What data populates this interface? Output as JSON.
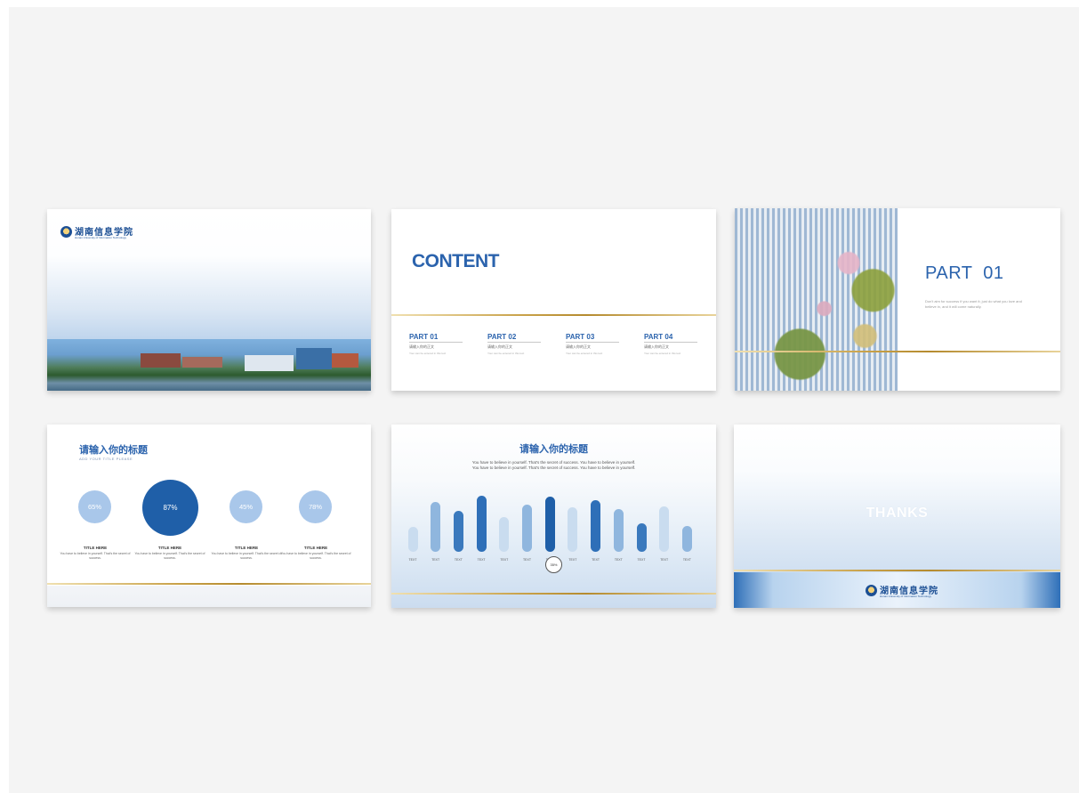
{
  "colors": {
    "background": "#f4f4f4",
    "primary_blue": "#2b63ad",
    "gold": "#c9a24a"
  },
  "slide1": {
    "logo_cn": "湖南信息学院",
    "logo_en": "Hunan University of Information Technology"
  },
  "slide2": {
    "title": "CONTENT",
    "parts": [
      {
        "title": "PART 01",
        "sub": "请输入你的正文",
        "desc": "Your can be entered in this text"
      },
      {
        "title": "PART 02",
        "sub": "请输入你的正文",
        "desc": "Your can be entered in this text"
      },
      {
        "title": "PART 03",
        "sub": "请输入你的正文",
        "desc": "Your can be entered in this text"
      },
      {
        "title": "PART 04",
        "sub": "请输入你的正文",
        "desc": "Your can be entered in this text"
      }
    ]
  },
  "slide3": {
    "title": "PART  01",
    "desc": "Don't aim for success if you want it; just do what you love and believe in, and it will come naturally."
  },
  "slide4": {
    "title": "请输入你的标题",
    "subtitle": "ADD YOUR TITLE PLEASE",
    "items": [
      {
        "percent": "65%",
        "value": 65,
        "label": "TITLE HERE",
        "desc": "You have to believe in yourself. That's the secret of success."
      },
      {
        "percent": "87%",
        "value": 87,
        "label": "TITLE HERE",
        "desc": "You have to believe in yourself. That's the secret of success."
      },
      {
        "percent": "45%",
        "value": 45,
        "label": "TITLE HERE",
        "desc": "You have to believe in yourself. That's the secret of success."
      },
      {
        "percent": "78%",
        "value": 78,
        "label": "TITLE HERE",
        "desc": "You have to believe in yourself. That's the secret of success."
      }
    ]
  },
  "slide5": {
    "title": "请输入你的标题",
    "desc": "You have to believe in yourself. That's the secret of success. You have to believe in yourself. You have to believe in yourself. That's the secret of success. You have to believe in yourself.",
    "highlight_percent": "35%",
    "bars": [
      {
        "label": "TEXT",
        "level": 0.4,
        "color": "#c9dcef"
      },
      {
        "label": "TEXT",
        "level": 0.8,
        "color": "#8fb6de"
      },
      {
        "label": "TEXT",
        "level": 0.65,
        "color": "#3a79bd"
      },
      {
        "label": "TEXT",
        "level": 0.9,
        "color": "#2e6fb8"
      },
      {
        "label": "TEXT",
        "level": 0.55,
        "color": "#c9dcef"
      },
      {
        "label": "TEXT",
        "level": 0.75,
        "color": "#8fb6de"
      },
      {
        "label": "TEXT",
        "level": 0.88,
        "color": "#1f5fa8"
      },
      {
        "label": "TEXT",
        "level": 0.72,
        "color": "#c9dcef"
      },
      {
        "label": "TEXT",
        "level": 0.83,
        "color": "#2e6fb8"
      },
      {
        "label": "TEXT",
        "level": 0.68,
        "color": "#8fb6de"
      },
      {
        "label": "TEXT",
        "level": 0.45,
        "color": "#3a79bd"
      },
      {
        "label": "TEXT",
        "level": 0.73,
        "color": "#c9dcef"
      },
      {
        "label": "TEXT",
        "level": 0.42,
        "color": "#8fb6de"
      }
    ]
  },
  "slide6": {
    "thanks": "THANKS",
    "logo_cn": "湖南信息学院",
    "logo_en": "Hunan University of Information Technology"
  }
}
